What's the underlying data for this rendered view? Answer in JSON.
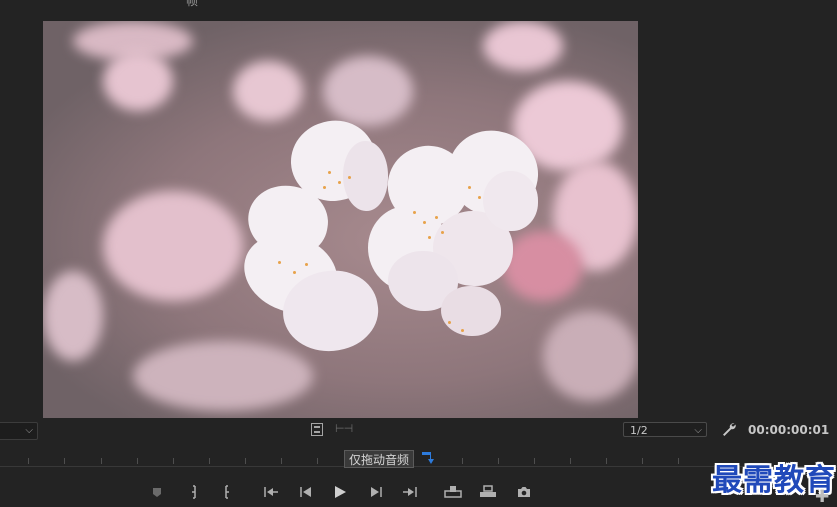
{
  "monitor": {
    "top_glyph": "帧",
    "zoom_select": "1/2",
    "timecode": "00:00:00:01"
  },
  "timeline": {
    "tooltip": "仅拖动音频"
  },
  "watermark": {
    "text": "最需教育"
  },
  "colors": {
    "background": "#232323",
    "accent_blue": "#2d7bdc",
    "watermark_blue": "#2049ba"
  }
}
